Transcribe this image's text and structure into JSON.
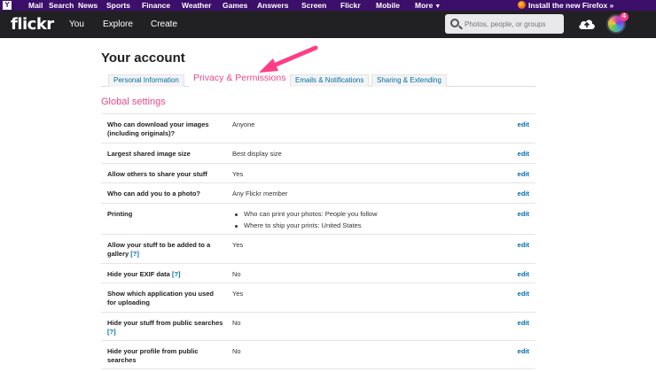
{
  "yahoo_bar": {
    "logo": "Y",
    "links": [
      "Mail",
      "Search",
      "News",
      "Sports",
      "Finance",
      "Weather",
      "Games",
      "Answers",
      "Screen",
      "Flickr",
      "Mobile",
      "More"
    ],
    "firefox_promo": "Install the new Firefox »"
  },
  "header": {
    "logo": "flickr",
    "nav": [
      "You",
      "Explore",
      "Create"
    ],
    "search_placeholder": "Photos, people, or groups",
    "notification_count": "4"
  },
  "page": {
    "title": "Your account",
    "tabs": [
      {
        "label": "Personal Information",
        "active": false
      },
      {
        "label": "Privacy & Permissions",
        "active": true
      },
      {
        "label": "Emails & Notifications",
        "active": false
      },
      {
        "label": "Sharing & Extending",
        "active": false
      }
    ],
    "section_title": "Global settings",
    "edit_label": "edit",
    "help_label": "[?]"
  },
  "settings": [
    {
      "label": "Who can download your images (including originals)?",
      "value": "Anyone"
    },
    {
      "label": "Largest shared image size",
      "value": "Best display size"
    },
    {
      "label": "Allow others to share your stuff",
      "value": "Yes"
    },
    {
      "label": "Who can add you to a photo?",
      "value": "Any Flickr member"
    },
    {
      "label": "Printing",
      "bullets": [
        "Who can print your photos: People you follow",
        "Where to ship your prints: United States"
      ]
    },
    {
      "label": "Allow your stuff to be added to a gallery",
      "value": "Yes",
      "help": true
    },
    {
      "label": "Hide your EXIF data",
      "value": "No",
      "help": true
    },
    {
      "label": "Show which application you used for uploading",
      "value": "Yes"
    },
    {
      "label": "Hide your stuff from public searches",
      "value": "No",
      "help": true
    },
    {
      "label": "Hide your profile from public searches",
      "value": "No"
    }
  ],
  "colors": {
    "yahoo_purple": "#3b0f6a",
    "flickr_dark": "#212124",
    "accent_pink": "#e5488c",
    "link_blue": "#006dac"
  }
}
